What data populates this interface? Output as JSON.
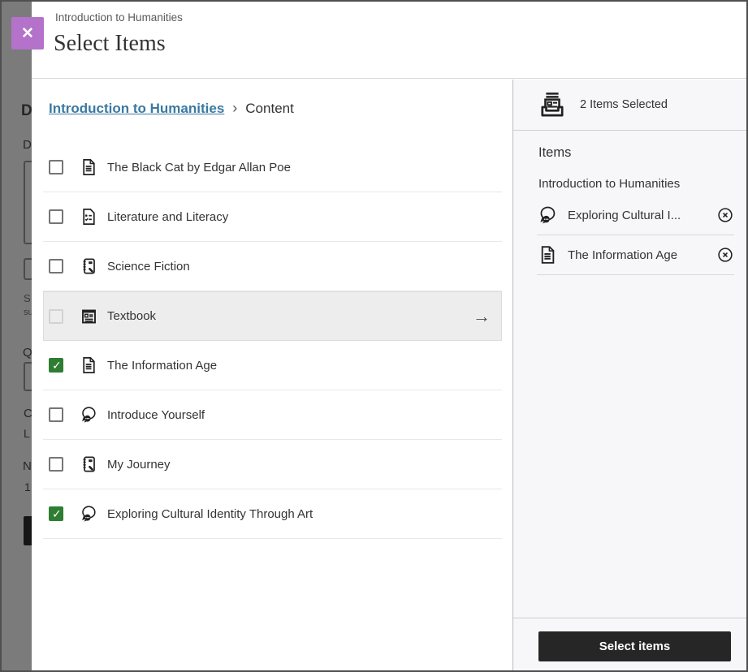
{
  "colors": {
    "accent_purple": "#b472ca",
    "accent_purple_dark": "#9450ad",
    "checked_green": "#2e7d32",
    "link_blue": "#3a79a1",
    "button_dark": "#262626",
    "overlay_gray": "#7b7b7b"
  },
  "background": {
    "fragments": [
      "D",
      "D",
      "S",
      "su",
      "Q",
      "C",
      "L",
      "N",
      "1"
    ]
  },
  "header": {
    "eyebrow": "Introduction to Humanities",
    "title": "Select Items",
    "close_glyph": "✕"
  },
  "breadcrumb": {
    "link": "Introduction to Humanities",
    "separator": "›",
    "current": "Content"
  },
  "list": {
    "items": [
      {
        "label": "The Black Cat by Edgar Allan Poe",
        "icon": "document-icon",
        "checked": false
      },
      {
        "label": "Literature and Literacy",
        "icon": "assessment-icon",
        "checked": false
      },
      {
        "label": "Science Fiction",
        "icon": "journal-icon",
        "checked": false
      },
      {
        "label": "Textbook",
        "icon": "textbook-icon",
        "checked": false,
        "arrow": "→"
      },
      {
        "label": "The Information Age",
        "icon": "document-icon",
        "checked": true
      },
      {
        "label": "Introduce Yourself",
        "icon": "discussion-icon",
        "checked": false
      },
      {
        "label": "My Journey",
        "icon": "journal-icon",
        "checked": false
      },
      {
        "label": "Exploring Cultural Identity Through Art",
        "icon": "discussion-icon",
        "checked": true
      }
    ]
  },
  "summary": {
    "count_label": "2 Items Selected",
    "count_icon": "collect-icon",
    "heading": "Items",
    "group": "Introduction to Humanities",
    "remove_icon": "circle-x-icon",
    "selected": [
      {
        "label": "Exploring Cultural I...",
        "icon": "discussion-icon"
      },
      {
        "label": "The Information Age",
        "icon": "document-icon"
      }
    ],
    "submit_label": "Select items"
  }
}
